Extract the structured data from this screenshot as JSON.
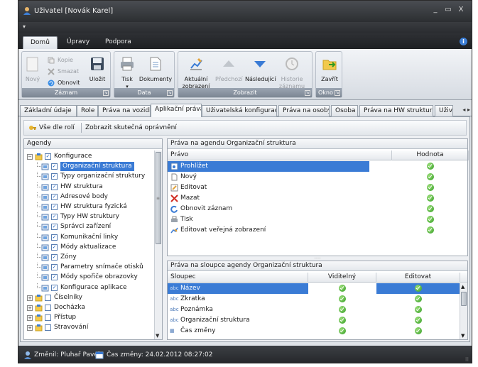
{
  "window": {
    "title": "Uživatel [Novák Karel]",
    "controls": [
      "_",
      "▭",
      "X"
    ]
  },
  "ribbon_tabs": [
    {
      "label": "Domů",
      "active": true
    },
    {
      "label": "Úpravy",
      "active": false
    },
    {
      "label": "Podpora",
      "active": false
    }
  ],
  "ribbon": {
    "groups": {
      "zaznam": "Záznam",
      "data": "Data",
      "zobrazit": "Zobrazit",
      "okno": "Okno"
    },
    "buttons": {
      "novy": "Nový",
      "kopie": "Kopie",
      "smazat": "Smazat",
      "obnovit": "Obnovit",
      "ulozit": "Uložit",
      "tisk": "Tisk",
      "dokumenty": "Dokumenty",
      "aktualni1": "Aktuální",
      "aktualni2": "zobrazení",
      "predchozi": "Předchozí",
      "nasledujici": "Následující",
      "historie1": "Historie",
      "historie2": "záznamu",
      "zavrit": "Zavřít"
    }
  },
  "main_tabs": [
    {
      "label": "Základní údaje",
      "active": false
    },
    {
      "label": "Role",
      "active": false
    },
    {
      "label": "Práva na vozidla",
      "active": false
    },
    {
      "label": "Aplikační práva",
      "active": true
    },
    {
      "label": "Uživatelská konfigurace",
      "active": false
    },
    {
      "label": "Práva na osoby",
      "active": false
    },
    {
      "label": "Osoba",
      "active": false
    },
    {
      "label": "Práva na HW strukturu",
      "active": false
    },
    {
      "label": "Uživ",
      "active": false
    }
  ],
  "toolbar": {
    "vse_dle_roli": "Vše dle rolí",
    "zobrazit_opravneni": "Zobrazit skutečná oprávnění"
  },
  "agendy": {
    "header": "Agendy",
    "items": [
      {
        "label": "Konfigurace",
        "level": 0,
        "checked": true,
        "expanded": true
      },
      {
        "label": "Organizační struktura",
        "level": 1,
        "checked": true,
        "selected": true
      },
      {
        "label": "Typy organizační struktury",
        "level": 1,
        "checked": true
      },
      {
        "label": "HW struktura",
        "level": 1,
        "checked": true
      },
      {
        "label": "Adresové body",
        "level": 1,
        "checked": true
      },
      {
        "label": "HW struktura fyzická",
        "level": 1,
        "checked": true
      },
      {
        "label": "Typy HW struktury",
        "level": 1,
        "checked": true
      },
      {
        "label": "Správci zařízení",
        "level": 1,
        "checked": true
      },
      {
        "label": "Komunikační linky",
        "level": 1,
        "checked": true
      },
      {
        "label": "Módy aktualizace",
        "level": 1,
        "checked": true
      },
      {
        "label": "Zóny",
        "level": 1,
        "checked": true
      },
      {
        "label": "Parametry snímače otisků",
        "level": 1,
        "checked": true
      },
      {
        "label": "Módy spořiče obrazovky",
        "level": 1,
        "checked": true
      },
      {
        "label": "Konfigurace aplikace",
        "level": 1,
        "checked": true
      },
      {
        "label": "Číselníky",
        "level": 0,
        "checked": false
      },
      {
        "label": "Docházka",
        "level": 0,
        "checked": false
      },
      {
        "label": "Přístup",
        "level": 0,
        "checked": false
      },
      {
        "label": "Stravování",
        "level": 0,
        "checked": false
      }
    ]
  },
  "prava_agenda": {
    "header": "Práva na agendu Organizační struktura",
    "col_pravo": "Právo",
    "col_hodnota": "Hodnota",
    "rows": [
      {
        "label": "Prohlížet",
        "icon": "view-icon"
      },
      {
        "label": "Nový",
        "icon": "new-doc-icon"
      },
      {
        "label": "Editovat",
        "icon": "edit-icon"
      },
      {
        "label": "Mazat",
        "icon": "delete-icon"
      },
      {
        "label": "Obnovit záznam",
        "icon": "refresh-icon"
      },
      {
        "label": "Tisk",
        "icon": "print-icon"
      },
      {
        "label": "Editovat veřejná zobrazení",
        "icon": "chart-icon"
      }
    ]
  },
  "prava_sloupce": {
    "header": "Práva na sloupce agendy Organizační struktura",
    "col_sloupec": "Sloupec",
    "col_viditelny": "Viditelný",
    "col_editovat": "Editovat",
    "rows": [
      {
        "label": "Název",
        "type": "abc"
      },
      {
        "label": "Zkratka",
        "type": "abc"
      },
      {
        "label": "Poznámka",
        "type": "abc"
      },
      {
        "label": "Organizační struktura",
        "type": "abc"
      },
      {
        "label": "Čas změny",
        "type": "date"
      }
    ]
  },
  "status": {
    "zmenil": "Změnil: Pluhař Pavel",
    "cas_zmeny": "Čas změny: 24.02.2012 08:27:02"
  }
}
